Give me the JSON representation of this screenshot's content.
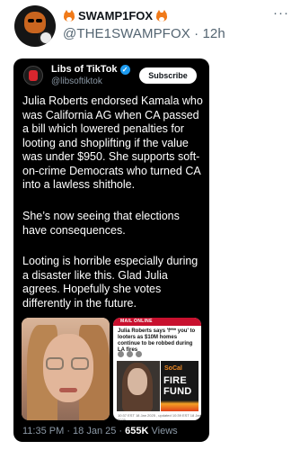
{
  "post": {
    "display_name": "SWAMP1FOX",
    "handle": "@THE1SWAMPFOX",
    "separator": " · ",
    "age": "12h",
    "more": "···"
  },
  "embed": {
    "account_name": "Libs of TikTok",
    "verified_glyph": "✓",
    "account_handle": "@libsoftiktok",
    "subscribe_label": "Subscribe",
    "paragraph_1": "Julia Roberts endorsed Kamala who was California AG when CA passed a bill which lowered penalties for looting and shoplifting if the value was under $950. She supports soft-on-crime Democrats who turned CA into a lawless shithole.",
    "paragraph_2": "She’s now seeing that elections have consequences.",
    "paragraph_3": "Looting is horrible especially during a disaster like this. Glad Julia agrees. Hopefully she votes differently in the future.",
    "timestamp": "11:35 PM · 18 Jan 25 · ",
    "views_count": "655K",
    "views_label": " Views"
  },
  "article": {
    "bar_text": "MAIL ONLINE",
    "headline": "Julia Roberts says 'f*** you' to looters as $10M homes continue to be robbed during LA fires",
    "socal": "SoCal",
    "fire": "FIRE",
    "fund": "FUND",
    "footer": "10:37 EST 18 Jan 2025 , updated 10:39 EST 18 Jan 2025"
  },
  "colors": {
    "accent_blue": "#1d9bf0",
    "card_bg": "#000000",
    "secondary_text": "#536471"
  },
  "icons": [
    "fox-emoji-icon",
    "verified-badge-icon",
    "more-options-icon"
  ]
}
